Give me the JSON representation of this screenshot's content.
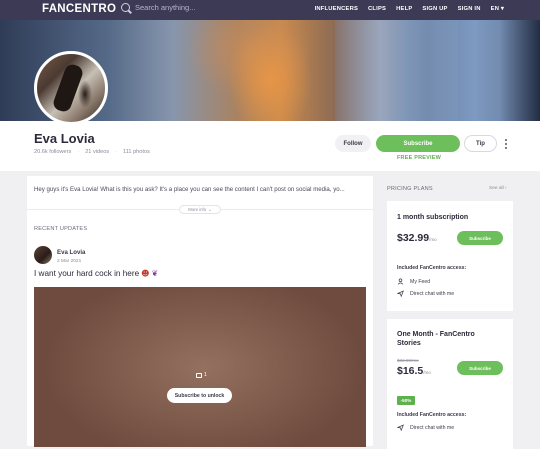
{
  "topbar": {
    "logo": "FANCENTRO",
    "search_placeholder": "Search anything...",
    "nav": [
      "INFLUENCERS",
      "CLIPS",
      "HELP",
      "SIGN UP",
      "SIGN IN",
      "EN ▾"
    ]
  },
  "profile": {
    "name": "Eva Lovia",
    "followers": "20.6k followers",
    "videos": "21 videos",
    "photos": "111 photos",
    "follow_label": "Follow",
    "subscribe_label": "Subscribe",
    "free_preview": "FREE PREVIEW",
    "tip_label": "Tip"
  },
  "bio": {
    "text": "Hey guys it's Eva Lovia! What is this you ask? It's a place you can see the content I can't post on social media, yo...",
    "more_info": "More info"
  },
  "updates": {
    "title": "RECENT UPDATES",
    "post": {
      "author": "Eva Lovia",
      "date": "2 Mar 2021",
      "text": "I want your hard cock in here",
      "image_count": "1",
      "unlock_label": "Subscribe to unlock"
    }
  },
  "plans": {
    "title": "PRICING PLANS",
    "see_all": "See all ›",
    "items": [
      {
        "name": "1 month subscription",
        "price": "$32.99",
        "price_unit": "/mo",
        "subscribe": "Subscribe",
        "access_title": "Included FanCentro access:",
        "access": [
          "My Feed",
          "Direct chat with me"
        ]
      },
      {
        "name_line1": "One Month - FanCentro",
        "name_line2": "Stories",
        "old_price": "$32.99/mo",
        "price": "$16.5",
        "price_unit": "/mo",
        "subscribe": "Subscribe",
        "discount": "-50%",
        "access_title": "Included FanCentro access:",
        "access": [
          "Direct chat with me"
        ]
      }
    ]
  },
  "colors": {
    "nav_bg": "#3d3a55",
    "accent_green": "#6cbf5a"
  }
}
